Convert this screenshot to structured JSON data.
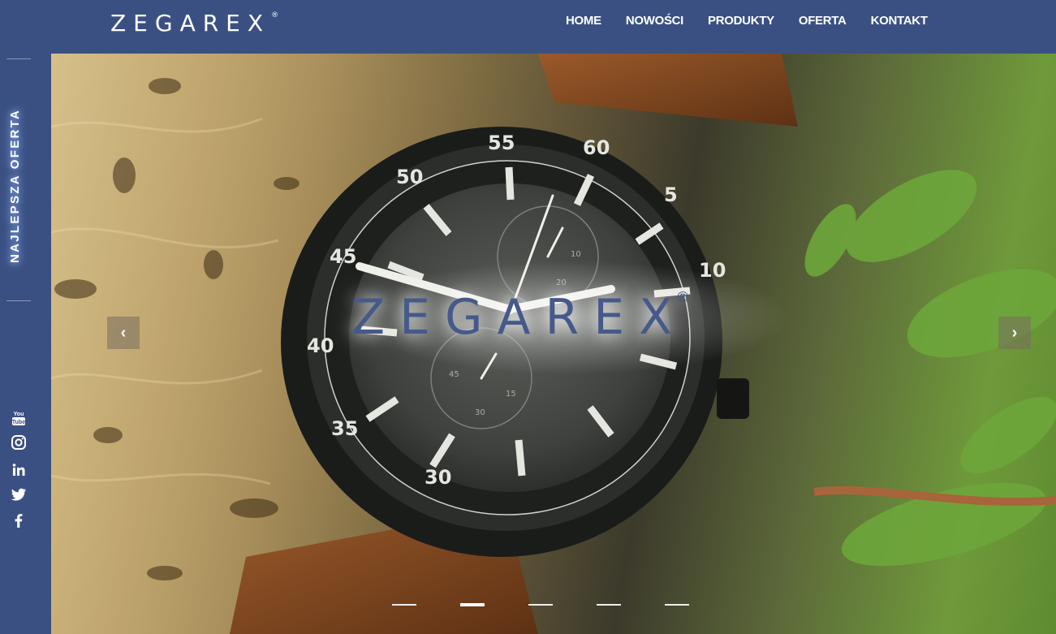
{
  "header": {
    "logo": "ZEGAREX",
    "logo_mark": "®",
    "nav": [
      "HOME",
      "NOWOŚCI",
      "PRODUKTY",
      "OFERTA",
      "KONTAKT"
    ]
  },
  "sidebar": {
    "vertical_label": "NAJLEPSZA OFERTA",
    "social": [
      "youtube-icon",
      "instagram-icon",
      "linkedin-icon",
      "twitter-icon",
      "facebook-icon"
    ]
  },
  "hero": {
    "logo": "ZEGAREX",
    "logo_mark": "®",
    "slides_count": 5,
    "active_slide": 2,
    "dial_numbers": [
      "55",
      "60",
      "5",
      "10",
      "50",
      "45",
      "40",
      "35",
      "30"
    ],
    "subdial_numbers": [
      "10",
      "20",
      "30",
      "15",
      "45"
    ]
  }
}
